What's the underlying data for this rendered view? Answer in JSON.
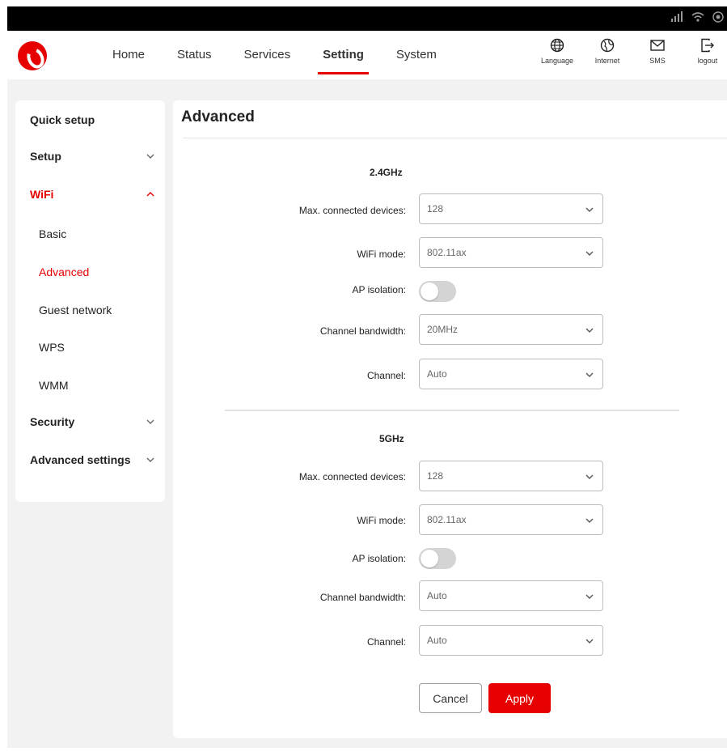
{
  "nav": {
    "tabs": [
      {
        "label": "Home"
      },
      {
        "label": "Status"
      },
      {
        "label": "Services"
      },
      {
        "label": "Setting",
        "active": true
      },
      {
        "label": "System"
      }
    ]
  },
  "tools": [
    {
      "label": "Language",
      "icon": "globe-icon"
    },
    {
      "label": "Internet",
      "icon": "internet-icon"
    },
    {
      "label": "SMS",
      "icon": "envelope-icon"
    },
    {
      "label": "logout",
      "icon": "logout-icon"
    }
  ],
  "sidebar": {
    "quick_setup": "Quick setup",
    "setup": "Setup",
    "wifi": "WiFi",
    "basic": "Basic",
    "advanced": "Advanced",
    "guest_network": "Guest network",
    "wps": "WPS",
    "wmm": "WMM",
    "security": "Security",
    "advanced_settings": "Advanced settings"
  },
  "main": {
    "title": "Advanced",
    "band24": {
      "title": "2.4GHz",
      "max_label": "Max. connected devices:",
      "max_value": "128",
      "mode_label": "WiFi mode:",
      "mode_value": "802.11ax",
      "ap_label": "AP isolation:",
      "ap_on": false,
      "bw_label": "Channel bandwidth:",
      "bw_value": "20MHz",
      "ch_label": "Channel:",
      "ch_value": "Auto"
    },
    "band5": {
      "title": "5GHz",
      "max_label": "Max. connected devices:",
      "max_value": "128",
      "mode_label": "WiFi mode:",
      "mode_value": "802.11ax",
      "ap_label": "AP isolation:",
      "ap_on": false,
      "bw_label": "Channel bandwidth:",
      "bw_value": "Auto",
      "ch_label": "Channel:",
      "ch_value": "Auto"
    },
    "cancel": "Cancel",
    "apply": "Apply"
  },
  "colors": {
    "accent": "#e60000",
    "background": "#f2f2f2"
  }
}
